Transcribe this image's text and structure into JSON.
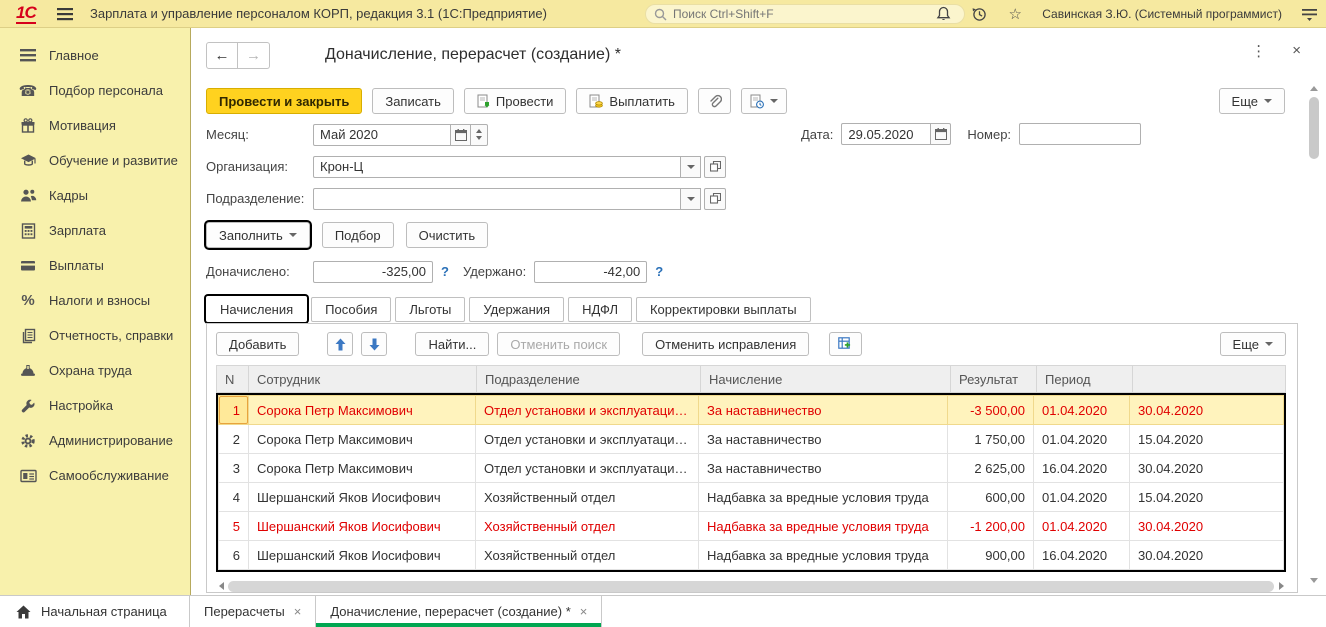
{
  "topbar": {
    "app_title": "Зарплата и управление персоналом КОРП, редакция 3.1  (1С:Предприятие)",
    "search_placeholder": "Поиск Ctrl+Shift+F",
    "user_name": "Савинская З.Ю. (Системный программист)"
  },
  "sidebar": {
    "items": [
      {
        "label": "Главное"
      },
      {
        "label": "Подбор персонала"
      },
      {
        "label": "Мотивация"
      },
      {
        "label": "Обучение и развитие"
      },
      {
        "label": "Кадры"
      },
      {
        "label": "Зарплата"
      },
      {
        "label": "Выплаты"
      },
      {
        "label": "Налоги и взносы"
      },
      {
        "label": "Отчетность, справки"
      },
      {
        "label": "Охрана труда"
      },
      {
        "label": "Настройка"
      },
      {
        "label": "Администрирование"
      },
      {
        "label": "Самообслуживание"
      }
    ]
  },
  "doc": {
    "title": "Доначисление, перерасчет (создание) *",
    "commands": {
      "post_and_close": "Провести и закрыть",
      "write": "Записать",
      "post": "Провести",
      "pay": "Выплатить",
      "more": "Еще"
    },
    "fields": {
      "month": {
        "label": "Месяц:",
        "value": "Май 2020"
      },
      "date": {
        "label": "Дата:",
        "value": "29.05.2020"
      },
      "number": {
        "label": "Номер:",
        "value": ""
      },
      "organization": {
        "label": "Организация:",
        "value": "Крон-Ц"
      },
      "department": {
        "label": "Подразделение:",
        "value": ""
      }
    },
    "fill_actions": {
      "fill": "Заполнить",
      "select": "Подбор",
      "clear": "Очистить"
    },
    "totals": {
      "accrued": {
        "label": "Доначислено:",
        "value": "-325,00",
        "help": "?"
      },
      "withheld": {
        "label": "Удержано:",
        "value": "-42,00",
        "help": "?"
      }
    },
    "tabs": [
      {
        "label": "Начисления"
      },
      {
        "label": "Пособия"
      },
      {
        "label": "Льготы"
      },
      {
        "label": "Удержания"
      },
      {
        "label": "НДФЛ"
      },
      {
        "label": "Корректировки выплаты"
      }
    ],
    "grid": {
      "toolbar": {
        "add": "Добавить",
        "find": "Найти...",
        "cancel_search": "Отменить поиск",
        "undo_corrections": "Отменить исправления",
        "more": "Еще"
      },
      "columns": [
        "N",
        "Сотрудник",
        "Подразделение",
        "Начисление",
        "Результат",
        "Период",
        ""
      ],
      "rows": [
        {
          "n": "1",
          "employee": "Сорока Петр Максимович",
          "department": "Отдел установки и эксплуатации...",
          "accrual": "За наставничество",
          "result": "-3 500,00",
          "period_from": "01.04.2020",
          "period_to": "30.04.2020"
        },
        {
          "n": "2",
          "employee": "Сорока Петр Максимович",
          "department": "Отдел установки и эксплуатации...",
          "accrual": "За наставничество",
          "result": "1 750,00",
          "period_from": "01.04.2020",
          "period_to": "15.04.2020"
        },
        {
          "n": "3",
          "employee": "Сорока Петр Максимович",
          "department": "Отдел установки и эксплуатации...",
          "accrual": "За наставничество",
          "result": "2 625,00",
          "period_from": "16.04.2020",
          "period_to": "30.04.2020"
        },
        {
          "n": "4",
          "employee": "Шершанский Яков Иосифович",
          "department": "Хозяйственный отдел",
          "accrual": "Надбавка за вредные условия труда",
          "result": "600,00",
          "period_from": "01.04.2020",
          "period_to": "15.04.2020"
        },
        {
          "n": "5",
          "employee": "Шершанский Яков Иосифович",
          "department": "Хозяйственный отдел",
          "accrual": "Надбавка за вредные условия труда",
          "result": "-1 200,00",
          "period_from": "01.04.2020",
          "period_to": "30.04.2020"
        },
        {
          "n": "6",
          "employee": "Шершанский Яков Иосифович",
          "department": "Хозяйственный отдел",
          "accrual": "Надбавка за вредные условия труда",
          "result": "900,00",
          "period_from": "16.04.2020",
          "period_to": "30.04.2020"
        }
      ]
    }
  },
  "bottombar": {
    "home": "Начальная страница",
    "tabs": [
      {
        "label": "Перерасчеты",
        "close": "×"
      },
      {
        "label": "Доначисление, перерасчет (создание) *",
        "close": "×"
      }
    ]
  },
  "colors": {
    "topbar_bg": "#f6e9a0",
    "sidebar_bg": "#f8f1ac",
    "primary_button_bg": "#ffd21f",
    "selected_row_bg": "#fff3bd",
    "corrected_text": "#e00000",
    "active_tab_underline": "#00a651",
    "toolbar_arrow_blue": "#3b78c3",
    "help_blue": "#2b71b8",
    "logo_red": "#d6001c"
  }
}
